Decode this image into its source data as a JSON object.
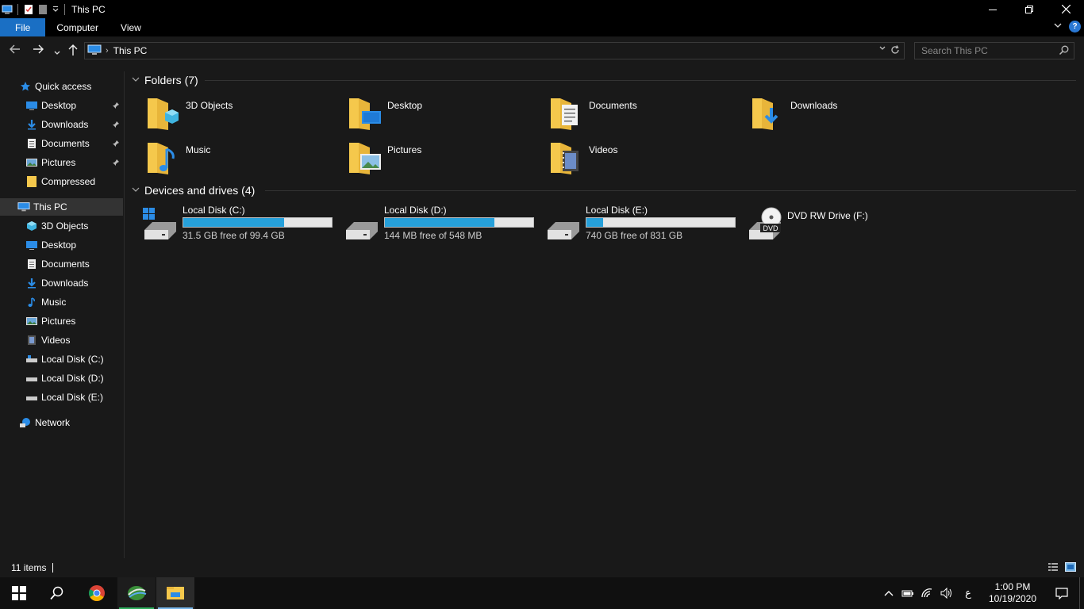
{
  "window": {
    "title": "This PC",
    "minimize_icon": "minimize-icon",
    "maximize_icon": "restore-icon",
    "close_icon": "close-icon"
  },
  "ribbon": {
    "tabs": [
      {
        "label": "File"
      },
      {
        "label": "Computer"
      },
      {
        "label": "View"
      }
    ]
  },
  "address": {
    "path": "This PC",
    "search_placeholder": "Search This PC"
  },
  "sidebar": {
    "quick_access": "Quick access",
    "quick_items": [
      {
        "label": "Desktop",
        "pinned": true
      },
      {
        "label": "Downloads",
        "pinned": true
      },
      {
        "label": "Documents",
        "pinned": true
      },
      {
        "label": "Pictures",
        "pinned": true
      },
      {
        "label": "Compressed",
        "pinned": false
      }
    ],
    "this_pc": "This PC",
    "pc_items": [
      {
        "label": "3D Objects"
      },
      {
        "label": "Desktop"
      },
      {
        "label": "Documents"
      },
      {
        "label": "Downloads"
      },
      {
        "label": "Music"
      },
      {
        "label": "Pictures"
      },
      {
        "label": "Videos"
      },
      {
        "label": "Local Disk (C:)"
      },
      {
        "label": "Local Disk (D:)"
      },
      {
        "label": "Local Disk (E:)"
      }
    ],
    "network": "Network"
  },
  "content": {
    "folders_header": "Folders (7)",
    "folders": [
      {
        "name": "3D Objects"
      },
      {
        "name": "Desktop"
      },
      {
        "name": "Documents"
      },
      {
        "name": "Downloads"
      },
      {
        "name": "Music"
      },
      {
        "name": "Pictures"
      },
      {
        "name": "Videos"
      }
    ],
    "drives_header": "Devices and drives (4)",
    "drives": [
      {
        "name": "Local Disk (C:)",
        "free": "31.5 GB free of 99.4 GB",
        "used_fraction": 0.68
      },
      {
        "name": "Local Disk (D:)",
        "free": "144 MB free of 548 MB",
        "used_fraction": 0.74
      },
      {
        "name": "Local Disk (E:)",
        "free": "740 GB free of 831 GB",
        "used_fraction": 0.11
      },
      {
        "name": "DVD RW Drive (F:)",
        "dvd_label": "DVD"
      }
    ]
  },
  "status": {
    "item_count": "11 items"
  },
  "taskbar": {
    "clock_time": "1:00 PM",
    "clock_date": "10/19/2020",
    "ime": "ع"
  },
  "colors": {
    "accent": "#1a6fc4",
    "bar_fill": "#26a0da",
    "folder": "#f5c84c"
  }
}
